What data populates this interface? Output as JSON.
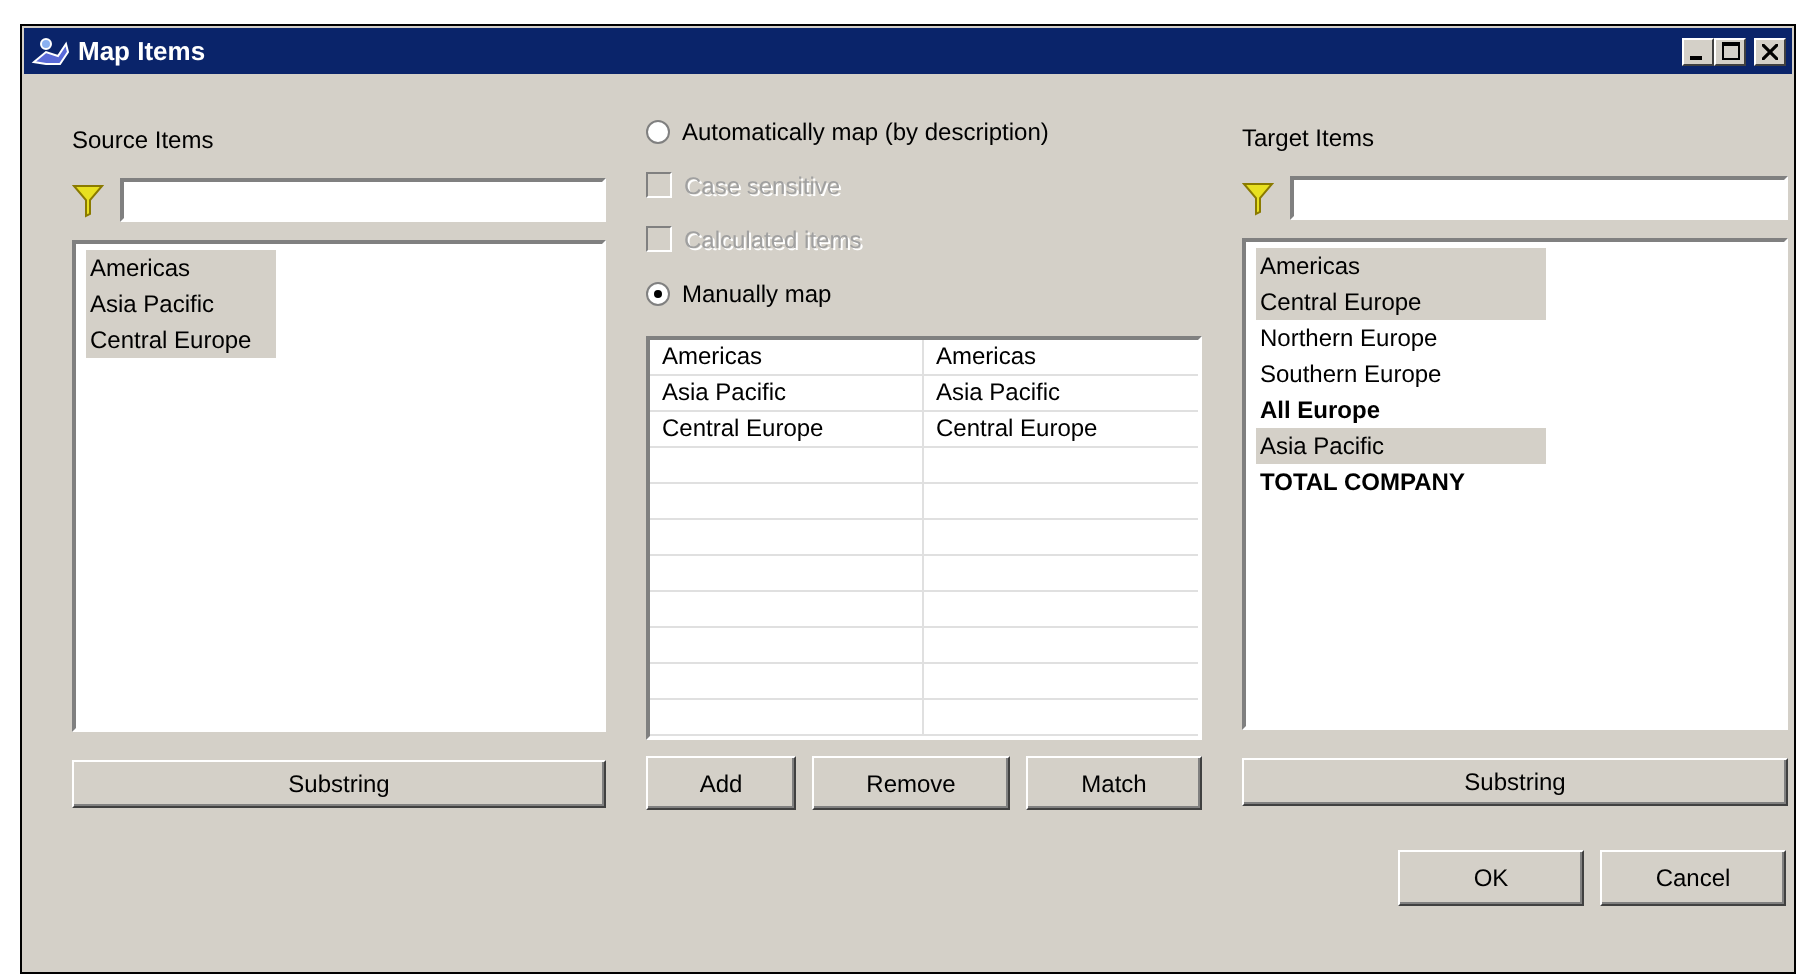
{
  "window": {
    "title": "Map Items"
  },
  "source": {
    "label": "Source Items",
    "items": [
      {
        "text": "Americas",
        "selected": true,
        "bold": false
      },
      {
        "text": "Asia Pacific",
        "selected": true,
        "bold": false
      },
      {
        "text": "Central Europe",
        "selected": true,
        "bold": false
      }
    ],
    "button": "Substring"
  },
  "mapping": {
    "options": [
      {
        "kind": "radio",
        "label": "Automatically map (by description)",
        "checked": false,
        "disabled": false
      },
      {
        "kind": "checkbox",
        "label": "Case sensitive",
        "checked": false,
        "disabled": true
      },
      {
        "kind": "checkbox",
        "label": "Calculated items",
        "checked": false,
        "disabled": true
      },
      {
        "kind": "radio",
        "label": "Manually map",
        "checked": true,
        "disabled": false
      }
    ],
    "rows": [
      [
        "Americas",
        "Americas"
      ],
      [
        "Asia Pacific",
        "Asia Pacific"
      ],
      [
        "Central Europe",
        "Central Europe"
      ]
    ],
    "buttons": [
      "Add",
      "Remove",
      "Match"
    ]
  },
  "target": {
    "label": "Target Items",
    "items": [
      {
        "text": "Americas",
        "selected": true,
        "bold": false
      },
      {
        "text": "Central Europe",
        "selected": true,
        "bold": false
      },
      {
        "text": "Northern Europe",
        "selected": false,
        "bold": false
      },
      {
        "text": "Southern Europe",
        "selected": false,
        "bold": false
      },
      {
        "text": "All Europe",
        "selected": false,
        "bold": true
      },
      {
        "text": "Asia Pacific",
        "selected": true,
        "bold": false
      },
      {
        "text": "TOTAL COMPANY",
        "selected": false,
        "bold": true
      }
    ],
    "button": "Substring"
  },
  "footer_buttons": [
    "OK",
    "Cancel"
  ]
}
